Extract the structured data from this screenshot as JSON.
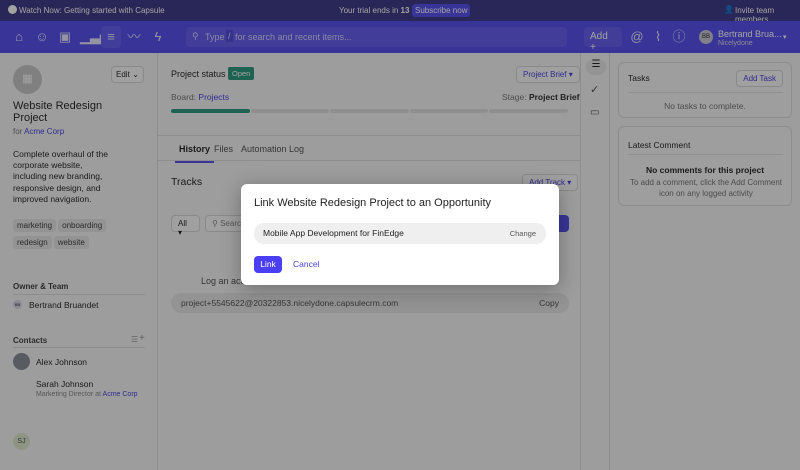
{
  "topbar": {
    "watch": "Watch Now: Getting started with Capsule",
    "trial": "Your trial ends in",
    "trial_days": "13 days",
    "subscribe": "Subscribe now",
    "invite": "Invite team members"
  },
  "nav": {
    "search_type": "Type",
    "search_slash": "/",
    "search_placeholder": "for search and recent items...",
    "add": "Add",
    "add_plus": "+",
    "user_initials": "BB",
    "user_name": "Bertrand Brua...",
    "user_org": "Nicelydone"
  },
  "project": {
    "edit": "Edit",
    "title": "Website Redesign Project",
    "for": "for",
    "company": "Acme Corp",
    "description": "Complete overhaul of the corporate website, including new branding, responsive design, and improved navigation.",
    "tags": [
      "marketing",
      "onboarding",
      "redesign",
      "website"
    ],
    "owner_heading": "Owner & Team",
    "owner_initials": "BB",
    "owner": "Bertrand Bruandet",
    "contacts_heading": "Contacts",
    "contacts": [
      {
        "name": "Alex Johnson"
      },
      {
        "initials": "SJ",
        "name": "Sarah Johnson",
        "role": "Marketing Director at",
        "company": "Acme Corp"
      }
    ]
  },
  "status": {
    "label": "Project status is",
    "value": "Open",
    "brief_button": "Project Brief",
    "board_label": "Board:",
    "board": "Projects",
    "stage_label": "Stage:",
    "stage": "Project Brief",
    "progress_stage": 1,
    "progress_total": 5
  },
  "tabs": [
    "History",
    "Files",
    "Automation Log"
  ],
  "tracks": {
    "title": "Tracks",
    "add_track": "Add Track",
    "filter": "All",
    "search_placeholder": "Search",
    "log_text": "Log an acti",
    "email": "project+5545622@20322853.nicelydone.capsulecrm.com",
    "copy": "Copy"
  },
  "tasks": {
    "title": "Tasks",
    "add": "Add Task",
    "empty": "No tasks to complete."
  },
  "comment": {
    "title": "Latest Comment",
    "empty_title": "No comments for this project",
    "empty_text": "To add a comment, click the Add Comment icon on any logged activity"
  },
  "modal": {
    "title": "Link Website Redesign Project to an Opportunity",
    "selected": "Mobile App Development for FinEdge",
    "change": "Change",
    "link": "Link",
    "cancel": "Cancel"
  },
  "colors": {
    "accent": "#4b44e0",
    "open": "#2f9a80"
  }
}
